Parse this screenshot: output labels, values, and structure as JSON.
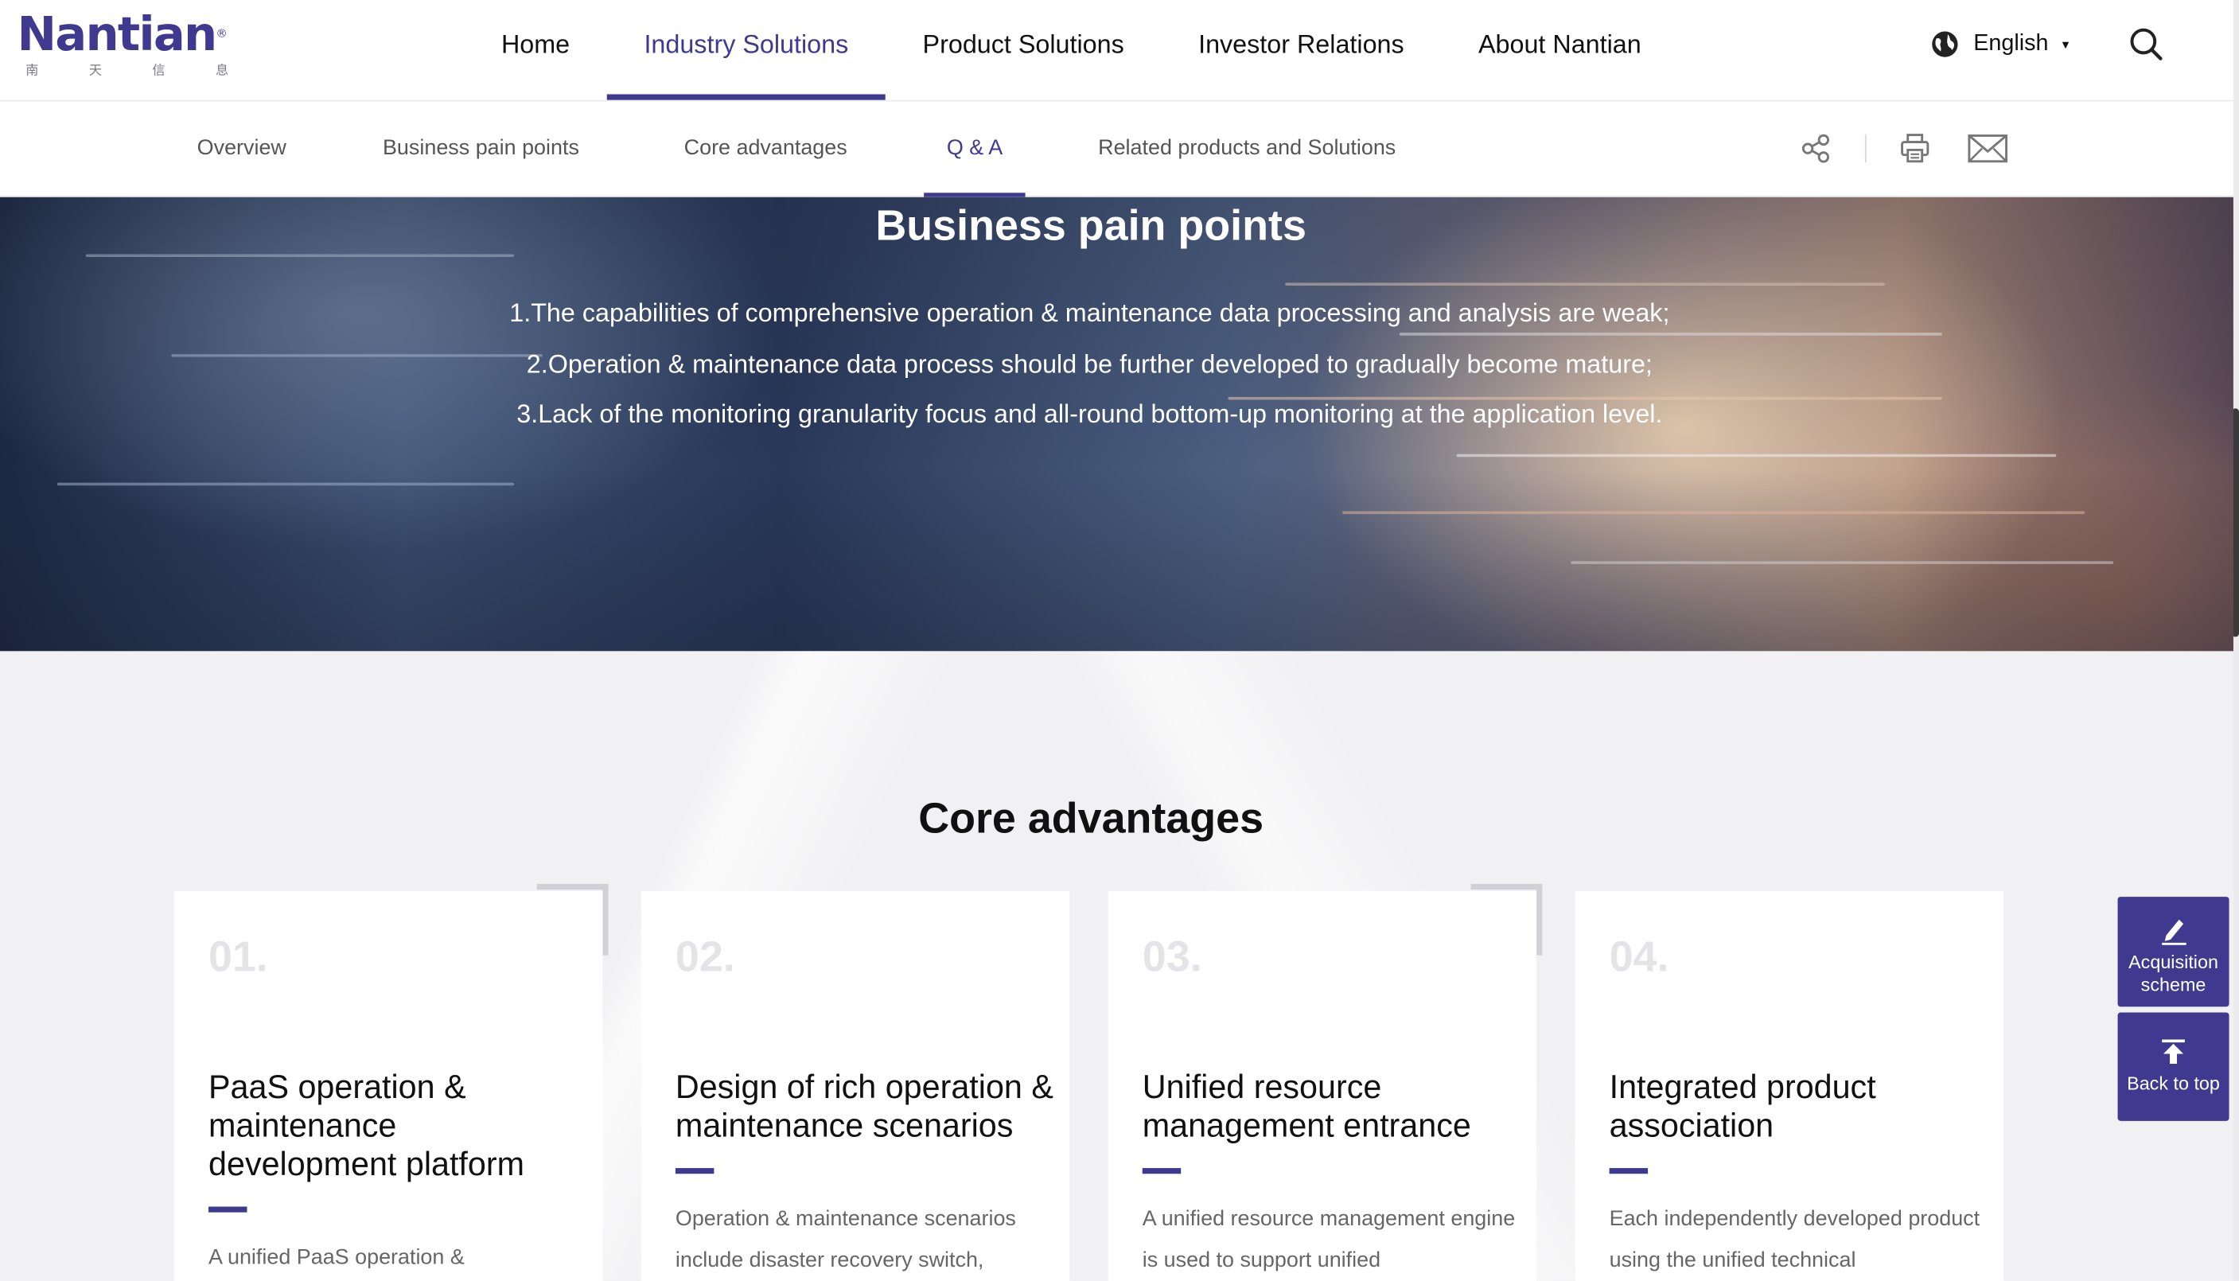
{
  "logo": {
    "word": "Nantian",
    "reg": "®",
    "sub": [
      "南",
      "天",
      "信",
      "息"
    ]
  },
  "nav": {
    "items": [
      {
        "label": "Home",
        "active": false
      },
      {
        "label": "Industry Solutions",
        "active": true
      },
      {
        "label": "Product Solutions",
        "active": false
      },
      {
        "label": "Investor Relations",
        "active": false
      },
      {
        "label": "About Nantian",
        "active": false
      }
    ],
    "language": "English"
  },
  "subnav": {
    "items": [
      {
        "label": "Overview",
        "active": false
      },
      {
        "label": "Business pain points",
        "active": false
      },
      {
        "label": "Core advantages",
        "active": false
      },
      {
        "label": "Q & A",
        "active": true
      },
      {
        "label": "Related products and Solutions",
        "active": false
      }
    ]
  },
  "banner": {
    "title": "Business pain points",
    "points": [
      "1.The capabilities of comprehensive operation & maintenance data processing and analysis are weak;",
      "2.Operation & maintenance data process should be further developed to gradually become mature;",
      "3.Lack of the monitoring granularity focus and all-round bottom-up monitoring at the application level."
    ]
  },
  "core": {
    "title": "Core advantages",
    "cards": [
      {
        "num": "01.",
        "title": "PaaS operation & maintenance development platform",
        "desc": "A unified PaaS operation &"
      },
      {
        "num": "02.",
        "title": "Design of rich operation & maintenance scenarios",
        "desc": "Operation & maintenance scenarios include disaster recovery switch,"
      },
      {
        "num": "03.",
        "title": "Unified resource management entrance",
        "desc": "A unified resource management engine is used to support unified"
      },
      {
        "num": "04.",
        "title": "Integrated product association",
        "desc": "Each independently developed product using the unified technical"
      }
    ]
  },
  "side": {
    "acquisition": "Acquisition scheme",
    "back_to_top": "Back to top"
  },
  "colors": {
    "brand": "#3f3a8f"
  }
}
